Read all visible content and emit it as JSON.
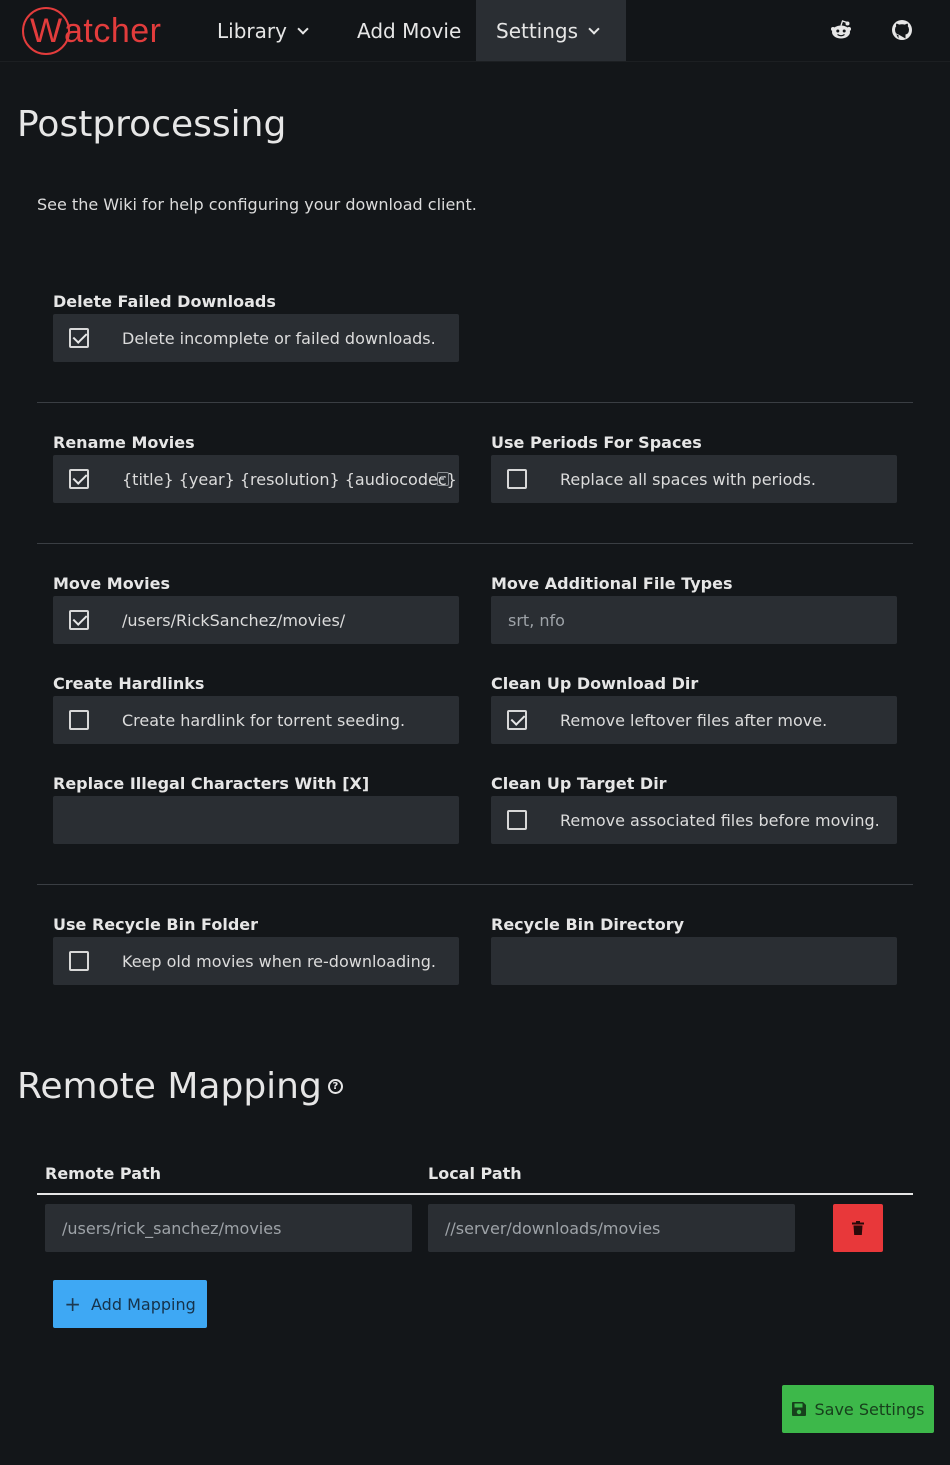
{
  "brand": {
    "initial": "W",
    "rest": "atcher"
  },
  "nav": {
    "library": "Library",
    "add_movie": "Add Movie",
    "settings": "Settings",
    "reddit_icon": "reddit-icon",
    "github_icon": "github-icon"
  },
  "page_title": "Postprocessing",
  "intro": "See the Wiki for help configuring your download client.",
  "settings": {
    "delete_failed": {
      "label": "Delete Failed Downloads",
      "text": "Delete incomplete or failed downloads.",
      "checked": true
    },
    "rename_movies": {
      "label": "Rename Movies",
      "value": "{title} {year} {resolution} {audiocodec}",
      "checked": true
    },
    "use_periods": {
      "label": "Use Periods For Spaces",
      "text": "Replace all spaces with periods.",
      "checked": false
    },
    "move_movies": {
      "label": "Move Movies",
      "value": "/users/RickSanchez/movies/",
      "checked": true
    },
    "move_additional": {
      "label": "Move Additional File Types",
      "placeholder": "srt, nfo"
    },
    "create_hardlinks": {
      "label": "Create Hardlinks",
      "text": "Create hardlink for torrent seeding.",
      "checked": false
    },
    "cleanup_download": {
      "label": "Clean Up Download Dir",
      "text": "Remove leftover files after move.",
      "checked": true
    },
    "replace_illegal": {
      "label": "Replace Illegal Characters With [X]",
      "value": ""
    },
    "cleanup_target": {
      "label": "Clean Up Target Dir",
      "text": "Remove associated files before moving.",
      "checked": false
    },
    "recycle_bin": {
      "label": "Use Recycle Bin Folder",
      "text": "Keep old movies when re-downloading.",
      "checked": false
    },
    "recycle_dir": {
      "label": "Recycle Bin Directory",
      "value": ""
    }
  },
  "remote_mapping": {
    "title": "Remote Mapping",
    "help": "?",
    "columns": [
      "Remote Path",
      "Local Path"
    ],
    "rows": [
      {
        "remote_placeholder": "/users/rick_sanchez/movies",
        "local_placeholder": "//server/downloads/movies"
      }
    ],
    "add_label": "Add Mapping",
    "add_icon": "+"
  },
  "save_label": "Save Settings",
  "colors": {
    "accent_red": "#e23c3c",
    "delete_red": "#e8383a",
    "add_blue": "#3ea8f4",
    "save_green": "#3db84a",
    "panel": "#2a2e33",
    "bg": "#131619"
  }
}
